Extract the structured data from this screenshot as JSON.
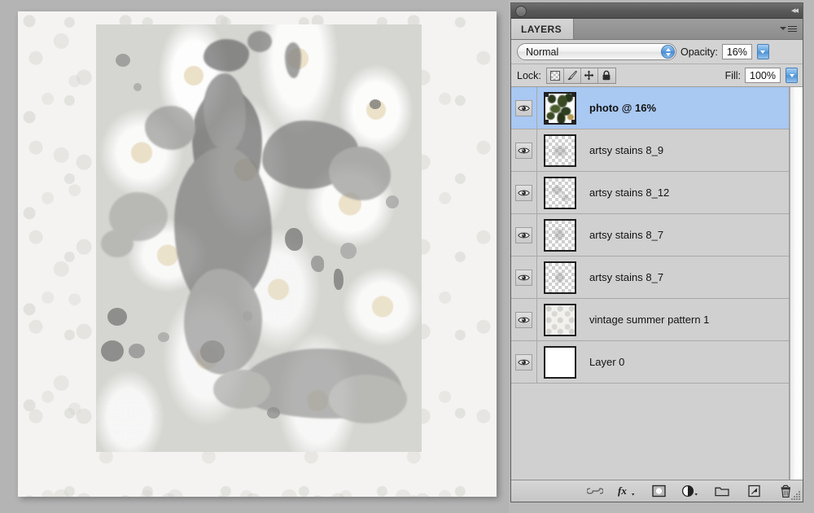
{
  "panel": {
    "dock_collapse_icon": "double-chevron-left-icon",
    "tab_label": "LAYERS",
    "menu_icon": "panel-menu-icon",
    "blend_mode": "Normal",
    "blend_mode_stepper_icon": "stepper-up-down-icon",
    "opacity_label": "Opacity:",
    "opacity_value": "16%",
    "opacity_dropdown_icon": "chevron-down-icon",
    "lock_label": "Lock:",
    "lock_buttons": [
      {
        "name": "lock-transparent-pixels-icon",
        "title": "transparency-checkerboard"
      },
      {
        "name": "lock-image-pixels-icon",
        "title": "paintbrush"
      },
      {
        "name": "lock-position-icon",
        "title": "move-cross"
      },
      {
        "name": "lock-all-icon",
        "title": "padlock"
      }
    ],
    "fill_label": "Fill:",
    "fill_value": "100%",
    "fill_dropdown_icon": "chevron-down-icon"
  },
  "layers": [
    {
      "name": "photo @ 16%",
      "visible": true,
      "selected": true,
      "thumb_type": "photo",
      "eye_icon": "eye-icon"
    },
    {
      "name": "artsy stains 8_9",
      "visible": true,
      "selected": false,
      "thumb_type": "transparent",
      "eye_icon": "eye-icon"
    },
    {
      "name": "artsy stains 8_12",
      "visible": true,
      "selected": false,
      "thumb_type": "transparent",
      "eye_icon": "eye-icon"
    },
    {
      "name": "artsy stains 8_7",
      "visible": true,
      "selected": false,
      "thumb_type": "transparent",
      "eye_icon": "eye-icon"
    },
    {
      "name": "artsy stains 8_7",
      "visible": true,
      "selected": false,
      "thumb_type": "transparent",
      "eye_icon": "eye-icon"
    },
    {
      "name": "vintage summer pattern 1",
      "visible": true,
      "selected": false,
      "thumb_type": "pattern",
      "eye_icon": "eye-icon"
    },
    {
      "name": "Layer 0",
      "visible": true,
      "selected": false,
      "thumb_type": "white",
      "eye_icon": "eye-icon"
    }
  ],
  "footer": {
    "buttons": [
      {
        "icon": "link-layers-icon",
        "glyph": "link"
      },
      {
        "icon": "layer-effects-fx-icon",
        "glyph": "fx"
      },
      {
        "icon": "add-layer-mask-icon",
        "glyph": "mask"
      },
      {
        "icon": "new-adjustment-layer-icon",
        "glyph": "half-circle"
      },
      {
        "icon": "new-group-icon",
        "glyph": "folder"
      },
      {
        "icon": "new-layer-icon",
        "glyph": "page"
      },
      {
        "icon": "delete-layer-icon",
        "glyph": "trash"
      }
    ],
    "resize_grip_icon": "resize-grip-icon"
  },
  "canvas": {
    "document_name": "artwork-canvas",
    "background_color": "#b4b4b4",
    "page_color": "#f4f3f1",
    "artwork_description": "watercolor daisies with grey ink wash blots"
  },
  "colors": {
    "selection_blue": "#a9c8f2",
    "panel_gray": "#d3d3d3",
    "row_gray": "#d0d0d0",
    "dock_dark": "#5a5a5a"
  }
}
